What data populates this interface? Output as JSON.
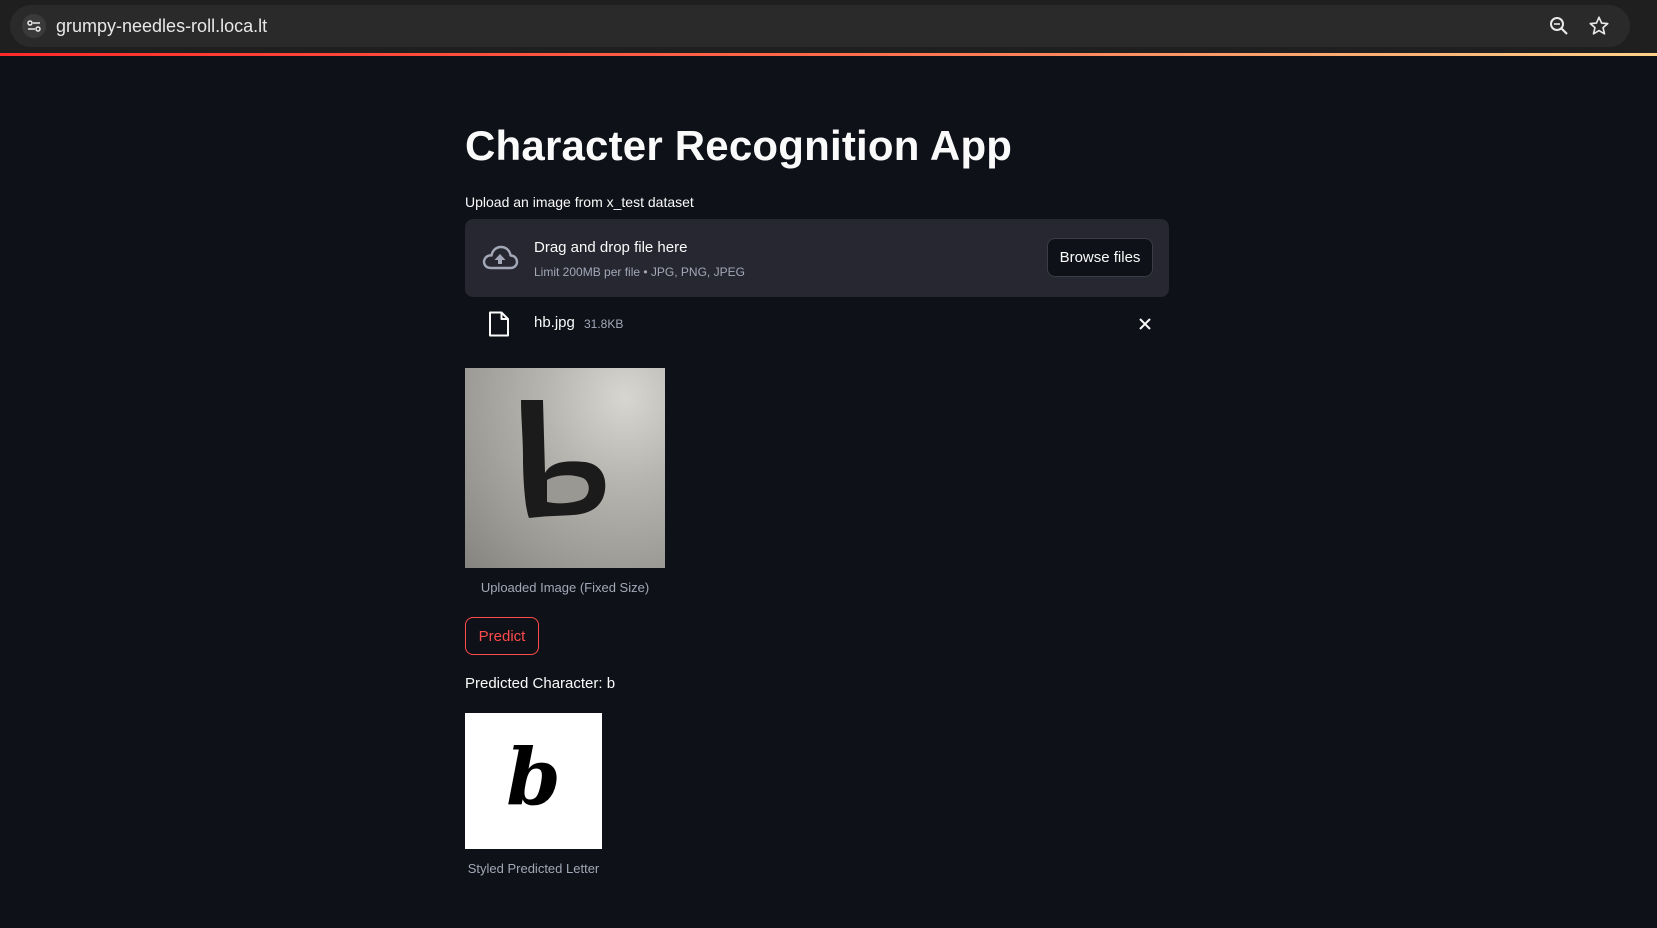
{
  "browser": {
    "url": "grumpy-needles-roll.loca.lt",
    "icons": [
      "site-info-icon",
      "zoom-icon",
      "bookmark-star-icon"
    ]
  },
  "app": {
    "title": "Character Recognition App",
    "uploader": {
      "label": "Upload an image from x_test dataset",
      "drop_title": "Drag and drop file here",
      "limit_text": "Limit 200MB per file • JPG, PNG, JPEG",
      "browse_label": "Browse files"
    },
    "file": {
      "name": "hb.jpg",
      "size": "31.8KB"
    },
    "uploaded_caption": "Uploaded Image (Fixed Size)",
    "predict_label": "Predict",
    "prediction_text": "Predicted Character: b",
    "styled_letter": "b",
    "styled_caption": "Styled Predicted Letter"
  },
  "colors": {
    "background": "#0e1117",
    "surface": "#262730",
    "accent": "#ff4b4b",
    "muted_text": "#a3a8b8"
  }
}
